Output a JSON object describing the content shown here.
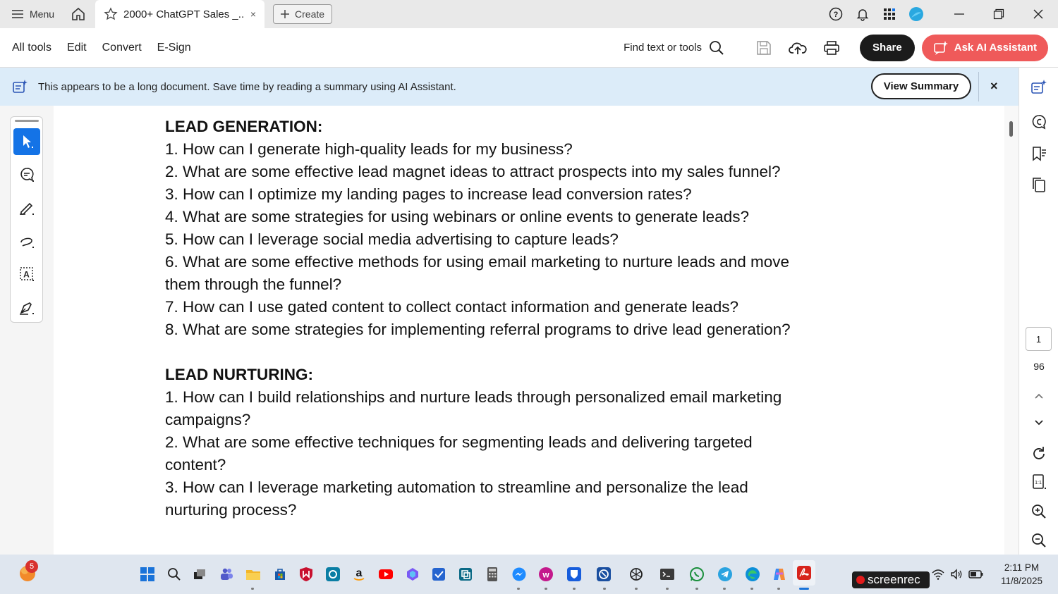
{
  "titlebar": {
    "menu_label": "Menu",
    "tab_title": "2000+ ChatGPT Sales _...",
    "tab_close": "×",
    "create_label": "Create"
  },
  "toolbar": {
    "menu_items": [
      "All tools",
      "Edit",
      "Convert",
      "E-Sign"
    ],
    "find_label": "Find text or tools",
    "share_label": "Share",
    "ai_label": "Ask AI Assistant"
  },
  "banner": {
    "text": "This appears to be a long document. Save time by reading a summary using AI Assistant.",
    "view_summary_label": "View Summary",
    "close": "×"
  },
  "document": {
    "lines": [
      {
        "text": "LEAD GENERATION:",
        "heading": true
      },
      {
        "text": "1. How can I generate high-quality leads for my business?"
      },
      {
        "text": "2. What are some effective lead magnet ideas to attract prospects into my sales funnel?"
      },
      {
        "text": "3. How can I optimize my landing pages to increase lead conversion rates?"
      },
      {
        "text": "4. What are some strategies for using webinars or online events to generate leads?"
      },
      {
        "text": "5. How can I leverage social media advertising to capture leads?"
      },
      {
        "text": "6. What are some effective methods for using email marketing to nurture leads and move"
      },
      {
        "text": "them through the funnel?"
      },
      {
        "text": "7. How can I use gated content to collect contact information and generate leads?"
      },
      {
        "text": "8. What are some strategies for implementing referral programs to drive lead generation?"
      },
      {
        "text": "",
        "gap": true
      },
      {
        "text": "LEAD NURTURING:",
        "heading": true
      },
      {
        "text": "1. How can I build relationships and nurture leads through personalized email marketing"
      },
      {
        "text": "campaigns?"
      },
      {
        "text": "2. What are some effective techniques for segmenting leads and delivering targeted"
      },
      {
        "text": "content?"
      },
      {
        "text": "3. How can I leverage marketing automation to streamline and personalize the lead"
      },
      {
        "text": "nurturing process?"
      }
    ]
  },
  "pagination": {
    "current_page": "1",
    "total_pages": "96"
  },
  "taskbar": {
    "notification_count": "5",
    "screenrec_label": "screenrec",
    "time": "2:11 PM",
    "date": "11/8/2025"
  },
  "colors": {
    "accent_blue": "#1473e6",
    "ai_button": "#ef5a5a",
    "banner_bg": "#dcecf9",
    "share_bg": "#1b1b1b"
  }
}
